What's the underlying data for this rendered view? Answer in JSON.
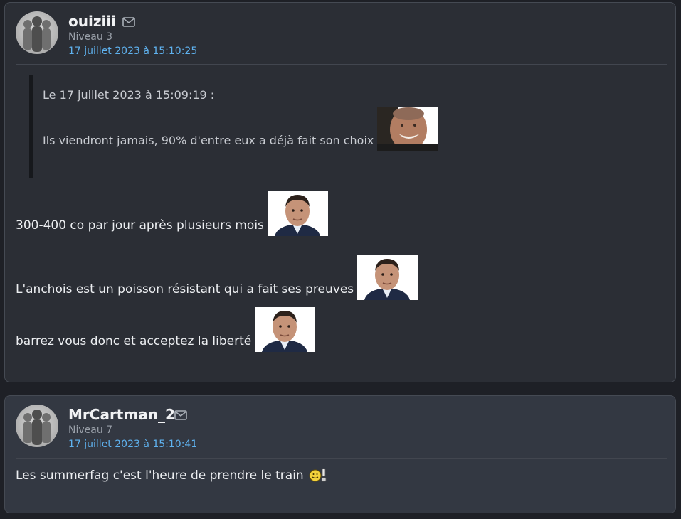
{
  "posts": [
    {
      "username": "ouiziii",
      "level": "Niveau 3",
      "date": "17 juillet 2023 à 15:10:25",
      "quote": {
        "header": "Le 17 juillet 2023 à 15:09:19 :",
        "text": "Ils viendront jamais, 90% d'entre eux a déjà fait son choix"
      },
      "lines": [
        "300-400 co par jour après plusieurs mois",
        "L'anchois est un poisson résistant qui a fait ses preuves",
        "barrez vous donc et acceptez la liberté"
      ]
    },
    {
      "username": "MrCartman_2",
      "level": "Niveau 7",
      "date": "17 juillet 2023 à 15:10:41",
      "lines": [
        "Les summerfag c'est l'heure de prendre le train"
      ]
    }
  ],
  "icons": {
    "mail": "mail-icon",
    "avatar": "default-avatar-silhouettes",
    "sticker_quote": "smiling-man-sticker",
    "sticker_line": "politician-portrait-sticker",
    "emoji": "smiley-train-emoji"
  },
  "colors": {
    "background": "#1e2026",
    "card": "#2b2e35",
    "card_alt": "#333842",
    "date_link": "#5fb2ef"
  }
}
